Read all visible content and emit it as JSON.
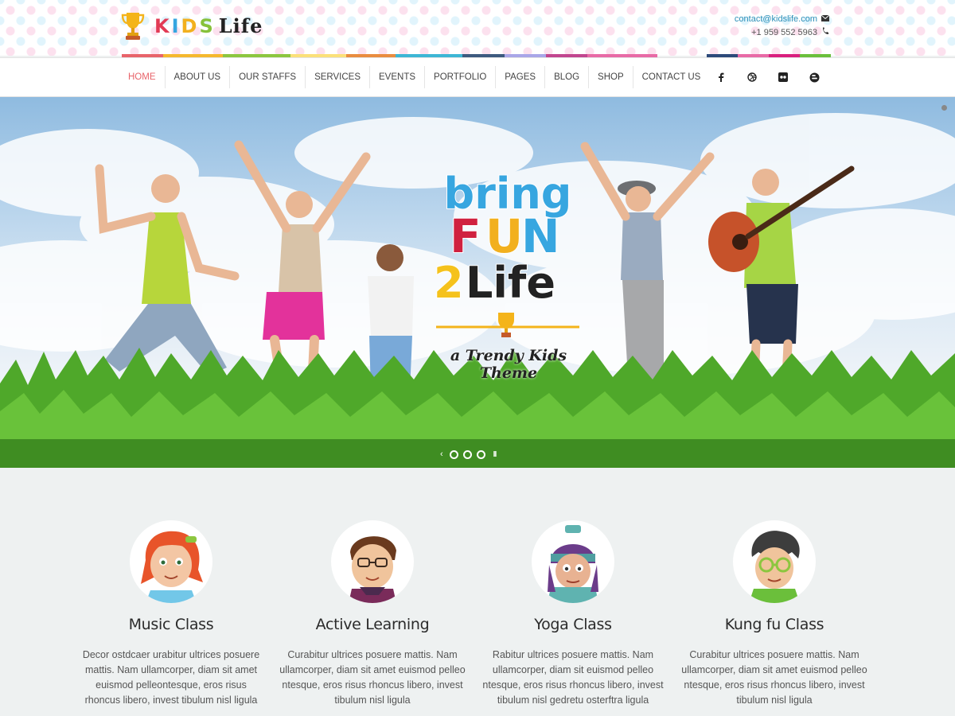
{
  "brand": {
    "letters": [
      "K",
      "I",
      "D",
      "S"
    ],
    "letter_colors": [
      "#e23b55",
      "#37a6e0",
      "#f2b01e",
      "#86c13a"
    ],
    "suffix": "Life",
    "trophy_color": "#f4b41a"
  },
  "contact": {
    "email": "contact@kidslife.com",
    "phone": "+1 959 552 5963",
    "email_icon": "envelope-icon",
    "phone_icon": "phone-icon"
  },
  "stripe_colors_left": [
    "#e8636a",
    "#f5b82e",
    "#8cc63f",
    "#fbe07a",
    "#e98c3f",
    "#3cb6d5",
    "#3d5a7f",
    "#a9a6e8",
    "#c2458f",
    "#e86aa6"
  ],
  "stripe_colors_right": [
    "#2d4a7a",
    "#e86aa6",
    "#d91e7e",
    "#6bbf3b"
  ],
  "nav": {
    "items": [
      {
        "label": "HOME",
        "active": true
      },
      {
        "label": "ABOUT US"
      },
      {
        "label": "OUR STAFFS"
      },
      {
        "label": "SERVICES"
      },
      {
        "label": "EVENTS"
      },
      {
        "label": "PORTFOLIO"
      },
      {
        "label": "PAGES"
      },
      {
        "label": "BLOG"
      },
      {
        "label": "SHOP"
      },
      {
        "label": "CONTACT US"
      }
    ],
    "social": [
      "facebook-icon",
      "dribbble-icon",
      "flickr-icon",
      "blogger-icon"
    ]
  },
  "hero": {
    "headline": {
      "line1": "bring",
      "line2": "FUN",
      "line3_number": "2",
      "line3_word": "Life",
      "line2_colors": [
        "#d0213f",
        "#f2b01e",
        "#37a6e0"
      ],
      "line1_color": "#37a6e0",
      "line3_colors": [
        "#f5c21c",
        "#222222"
      ]
    },
    "tagline": "a Trendy Kids Theme",
    "slides": 3,
    "controls": {
      "prev": "‹",
      "pause": "II"
    }
  },
  "classes": [
    {
      "title": "Music Class",
      "avatar": "redhead-girl-avatar",
      "description": "Decor ostdcaer urabitur ultrices posuere mattis. Nam ullamcorper, diam sit amet euismod pelleontesque, eros risus rhoncus libero, invest tibulum nisl ligula"
    },
    {
      "title": "Active Learning",
      "avatar": "boy-glasses-avatar",
      "description": "Curabitur ultrices posuere mattis. Nam ullamcorper, diam sit amet euismod pelleo ntesque, eros risus rhoncus libero, invest tibulum nisl ligula"
    },
    {
      "title": "Yoga Class",
      "avatar": "hat-kid-avatar",
      "description": "Rabitur ultrices posuere mattis. Nam ullamcorper, diam sit  euismod pelleo ntesque, eros risus rhoncus libero, invest tibulum nisl gedretu osterftra ligula"
    },
    {
      "title": "Kung fu Class",
      "avatar": "green-glasses-boy-avatar",
      "description": "Curabitur ultrices posuere mattis. Nam ullamcorper, diam sit amet euismod pelleo ntesque, eros risus rhoncus libero, invest tibulum nisl ligula"
    }
  ]
}
